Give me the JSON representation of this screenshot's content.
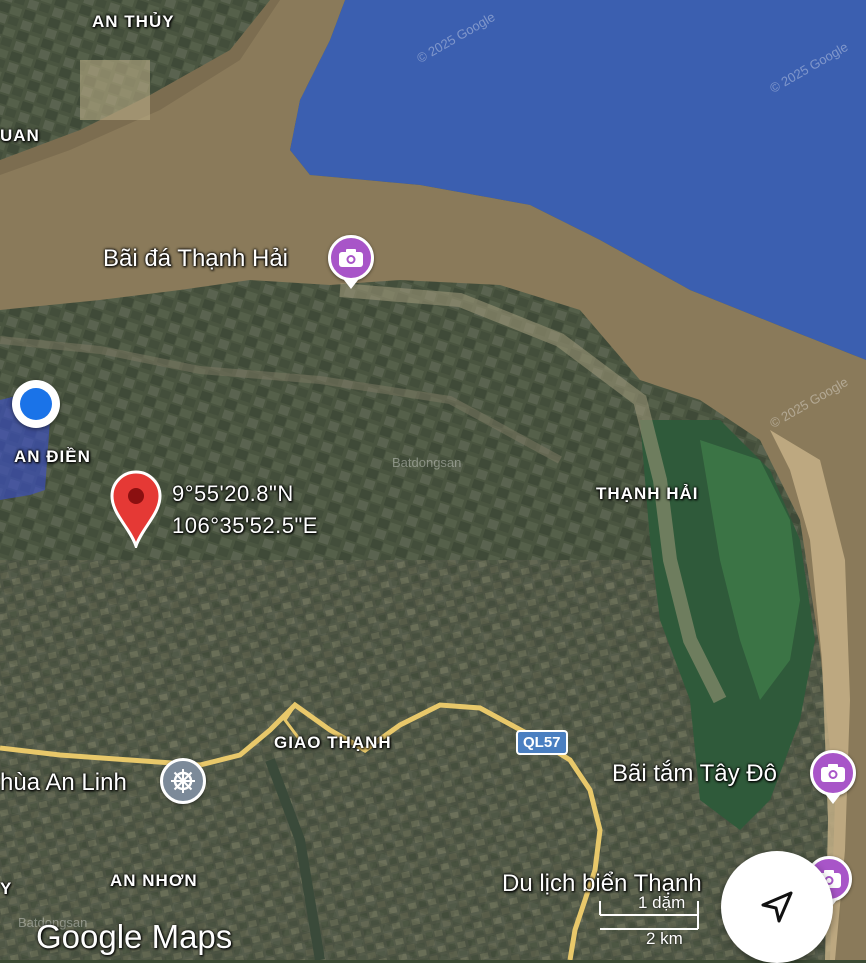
{
  "map_type": "satellite",
  "colors": {
    "sea": "#3b5fb0",
    "mudflat": "#8a7a5a",
    "land": "#45503a",
    "road": "#e8c86a",
    "pin": "#e53935",
    "poi": "#a855c8",
    "location_dot": "#1a73e8"
  },
  "areas": {
    "an_thuy": "AN THỦY",
    "uan": "UAN",
    "an_dien": "AN ĐIỀN",
    "thanh_hai": "THẠNH HẢI",
    "giao_thanh": "GIAO THẠNH",
    "an_nhon": "AN NHƠN",
    "y_edge": "Y"
  },
  "pois": {
    "bai_da": "Bãi đá Thạnh Hải",
    "bai_tam": "Bãi tắm Tây Đô",
    "du_lich": "Du lịch biển Thạnh",
    "chua": "hùa An Linh"
  },
  "pin": {
    "lat": "9°55'20.8\"N",
    "lng": "106°35'52.5\"E"
  },
  "road_shield": "QL57",
  "scale": {
    "top": "1 dặm",
    "bottom": "2 km"
  },
  "branding": {
    "logo": "Google Maps",
    "watermark": "© 2025 Google",
    "site_watermark": "Batdongsan"
  },
  "icons": {
    "nav": "navigation-arrow-icon",
    "poi": "camera-icon",
    "temple": "dharma-wheel-icon",
    "pin": "map-pin-icon",
    "location": "location-dot-icon"
  }
}
